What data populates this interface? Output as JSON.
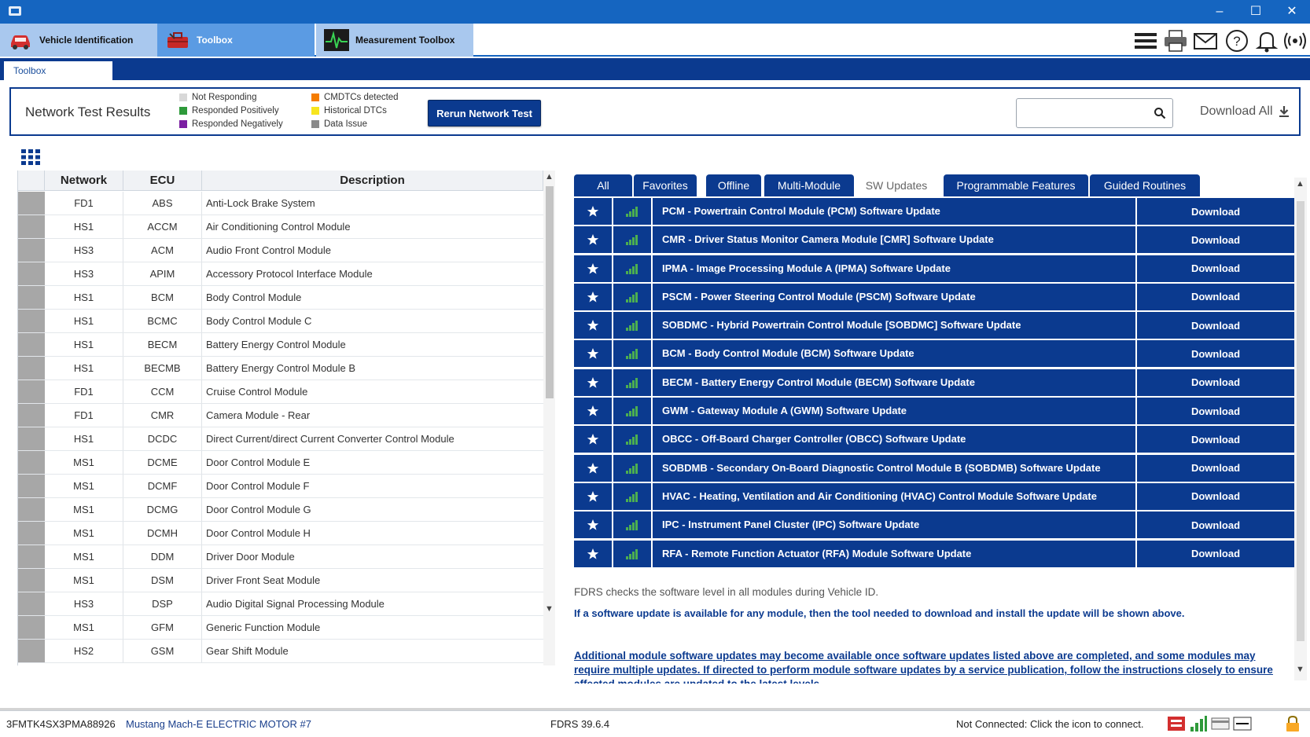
{
  "window": {
    "title": "",
    "minimize": "–",
    "maximize": "☐",
    "close": "✕"
  },
  "module_tabs": [
    {
      "label": "Vehicle Identification",
      "icon": "car-icon"
    },
    {
      "label": "Toolbox",
      "icon": "toolbox-icon"
    },
    {
      "label": "Measurement Toolbox",
      "icon": "waveform-icon"
    }
  ],
  "toolbar_icons": [
    "menu-icon",
    "print-icon",
    "mail-icon",
    "help-icon",
    "bell-icon",
    "wireless-icon"
  ],
  "sub_tab": "Toolbox",
  "network_test": {
    "title": "Network Test Results",
    "legend": [
      {
        "label": "Not Responding",
        "color": "#d8d8d8"
      },
      {
        "label": "Responded Positively",
        "color": "#2e9a3a"
      },
      {
        "label": "Responded Negatively",
        "color": "#7b1fa2"
      },
      {
        "label": "CMDTCs detected",
        "color": "#f57c00"
      },
      {
        "label": "Historical DTCs",
        "color": "#f7e51e"
      },
      {
        "label": "Data Issue",
        "color": "#8a8a8a"
      }
    ],
    "rerun_label": "Rerun Network Test",
    "search_placeholder": "",
    "download_all_label": "Download All"
  },
  "ecu_table": {
    "headers": [
      "Network",
      "ECU",
      "Description"
    ],
    "rows": [
      [
        "FD1",
        "ABS",
        "Anti-Lock Brake System"
      ],
      [
        "HS1",
        "ACCM",
        "Air Conditioning Control Module"
      ],
      [
        "HS3",
        "ACM",
        "Audio Front Control Module"
      ],
      [
        "HS3",
        "APIM",
        "Accessory Protocol Interface Module"
      ],
      [
        "HS1",
        "BCM",
        "Body Control Module"
      ],
      [
        "HS1",
        "BCMC",
        "Body Control Module C"
      ],
      [
        "HS1",
        "BECM",
        "Battery Energy Control Module"
      ],
      [
        "HS1",
        "BECMB",
        "Battery Energy Control Module B"
      ],
      [
        "FD1",
        "CCM",
        "Cruise Control Module"
      ],
      [
        "FD1",
        "CMR",
        "Camera Module - Rear"
      ],
      [
        "HS1",
        "DCDC",
        "Direct Current/direct Current Converter Control Module"
      ],
      [
        "MS1",
        "DCME",
        "Door Control Module E"
      ],
      [
        "MS1",
        "DCMF",
        "Door Control Module F"
      ],
      [
        "MS1",
        "DCMG",
        "Door Control Module G"
      ],
      [
        "MS1",
        "DCMH",
        "Door Control Module H"
      ],
      [
        "MS1",
        "DDM",
        "Driver Door Module"
      ],
      [
        "MS1",
        "DSM",
        "Driver Front Seat Module"
      ],
      [
        "HS3",
        "DSP",
        "Audio Digital Signal Processing Module"
      ],
      [
        "MS1",
        "GFM",
        "Generic Function Module"
      ],
      [
        "HS2",
        "GSM",
        "Gear Shift Module"
      ]
    ]
  },
  "right_tabs": [
    {
      "label": "All",
      "active": false
    },
    {
      "label": "Favorites",
      "active": false
    },
    {
      "label": "Offline",
      "active": false
    },
    {
      "label": "Multi-Module",
      "active": false
    },
    {
      "label": "SW Updates",
      "active": true
    },
    {
      "label": "Programmable Features",
      "active": false
    },
    {
      "label": "Guided Routines",
      "active": false
    }
  ],
  "sw_updates": {
    "download_label": "Download",
    "items": [
      "PCM - Powertrain Control Module (PCM) Software Update",
      "CMR - Driver Status Monitor Camera Module [CMR] Software Update",
      "IPMA - Image Processing Module A (IPMA) Software Update",
      "PSCM - Power Steering Control Module (PSCM) Software Update",
      "SOBDMC - Hybrid Powertrain Control Module [SOBDMC] Software Update",
      "BCM - Body Control Module (BCM) Software Update",
      "BECM - Battery Energy Control Module (BECM) Software Update",
      "GWM - Gateway Module A (GWM) Software Update",
      "OBCC - Off-Board Charger Controller (OBCC) Software Update",
      "SOBDMB - Secondary On-Board Diagnostic Control Module B (SOBDMB) Software Update",
      "HVAC - Heating, Ventilation and Air Conditioning (HVAC) Control Module Software Update",
      "IPC - Instrument Panel Cluster (IPC) Software Update",
      "RFA - Remote Function Actuator (RFA) Module Software Update"
    ]
  },
  "info": {
    "line1": "FDRS checks the software level in all modules during Vehicle ID.",
    "line2": "If a software update is available for any module, then the tool needed to download and install the update will be shown above.",
    "line3": "Additional module software updates may become available once software updates listed above are completed, and some modules may require multiple updates. If directed to perform module software updates by a service publication, follow the instructions closely to ensure affected modules are updated to the latest levels."
  },
  "status_bar": {
    "vin": "3FMTK4SX3PMA88926",
    "vehicle": "Mustang Mach-E ELECTRIC MOTOR #7",
    "version": "FDRS 39.6.4",
    "connection": "Not Connected: Click the icon to connect.",
    "icons": [
      "vci-red-icon",
      "signal-icon",
      "card-icon",
      "dash-icon",
      "lock-icon"
    ]
  },
  "colors": {
    "brand_blue": "#0b3a8f",
    "titlebar_blue": "#1565c0",
    "tab_light": "#a9c8ee",
    "tab_active": "#5b9be3",
    "signal_green": "#4caf50"
  }
}
